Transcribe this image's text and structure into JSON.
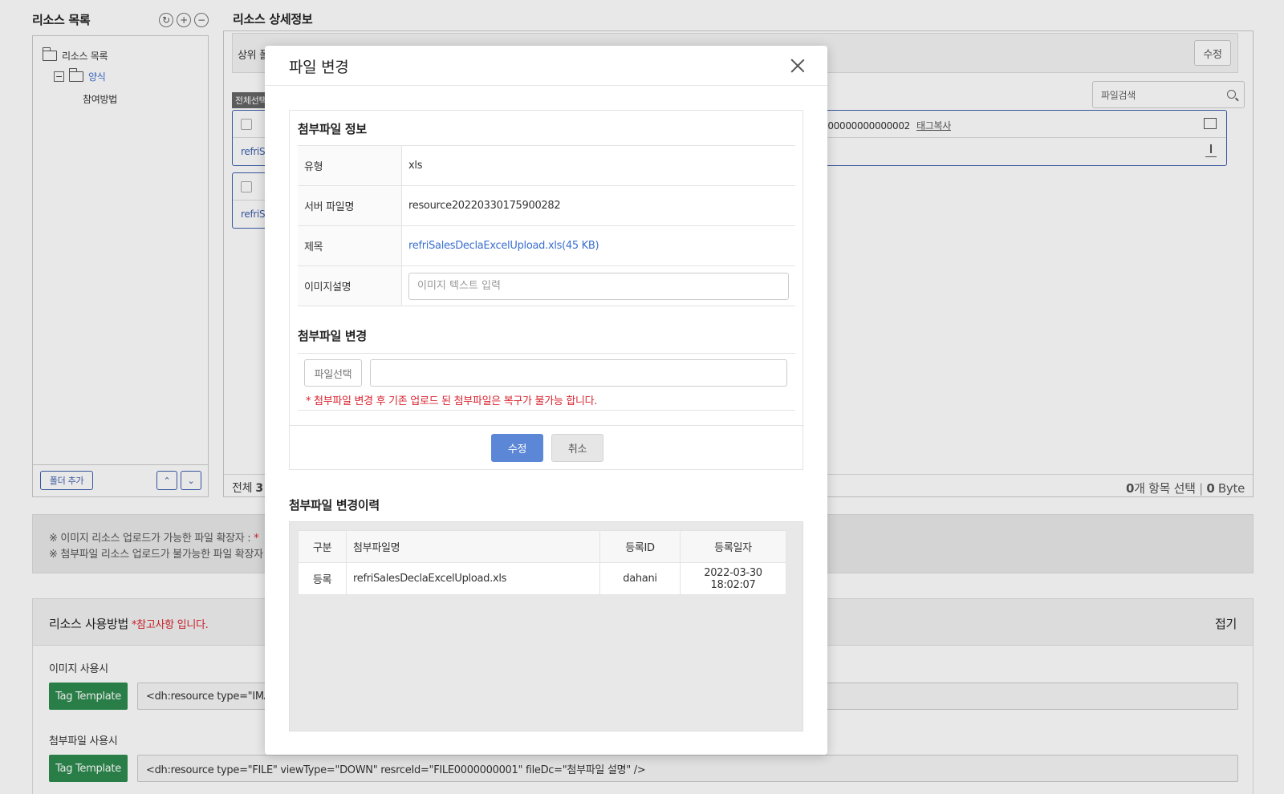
{
  "left_panel": {
    "title": "리소스 목록",
    "tree": [
      {
        "label": "리소스 목록"
      },
      {
        "label": "양식"
      },
      {
        "label": "참여방법"
      }
    ],
    "add_folder_button": "폴더 추가"
  },
  "right_panel": {
    "title": "리소스 상세정보",
    "parent_label": "상위 폴",
    "edit_button": "수정",
    "search_placeholder": "파일검색",
    "select_all": "전체선택",
    "card1": {
      "link_text": "refriS",
      "resource_id_text": "000000000000002",
      "tag_copy": "태그복사"
    },
    "card2": {
      "link_text": "refriS"
    },
    "total_label": "전체",
    "total_count": "3",
    "selected_count": "0",
    "selected_suffix": "개 항목 선택",
    "size_value": "0",
    "size_unit": "Byte"
  },
  "notice": {
    "line1": "※ 이미지 리소스 업로드가 가능한 파일 확장자 :",
    "line1_mark": "*",
    "line2": "※ 첨부파일 리소스 업로드가 불가능한 파일 확장자"
  },
  "usage": {
    "title": "리소스 사용방법",
    "required_note": "*참고사항 입니다.",
    "fold_label": "접기",
    "image_label": "이미지 사용시",
    "tag_button": "Tag Template",
    "image_tag": "<dh:resource type=\"IMAG",
    "file_label": "첨부파일 사용시",
    "file_tag": "<dh:resource type=\"FILE\" viewType=\"DOWN\" resrceId=\"FILE0000000001\" fileDc=\"첨부파일 설명\" />"
  },
  "modal": {
    "title": "파일 변경",
    "info_title": "첨부파일 정보",
    "rows": {
      "type_label": "유형",
      "type_value": "xls",
      "server_label": "서버 파일명",
      "server_value": "resource20220330175900282",
      "subject_label": "제목",
      "subject_value": "refriSalesDeclaExcelUpload.xls(45 KB)",
      "desc_label": "이미지설명",
      "desc_placeholder": "이미지 텍스트 입력"
    },
    "change_title": "첨부파일 변경",
    "file_select_button": "파일선택",
    "warning": "* 첨부파일 변경 후 기존 업로드 된 첨부파일은 복구가 불가능 합니다.",
    "submit_button": "수정",
    "cancel_button": "취소",
    "history_title": "첨부파일 변경이력",
    "history_columns": [
      "구분",
      "첨부파일명",
      "등록ID",
      "등록일자"
    ],
    "history_rows": [
      {
        "type": "등록",
        "file": "refriSalesDeclaExcelUpload.xls",
        "user": "dahani",
        "date": "2022-03-30 18:02:07"
      }
    ]
  }
}
